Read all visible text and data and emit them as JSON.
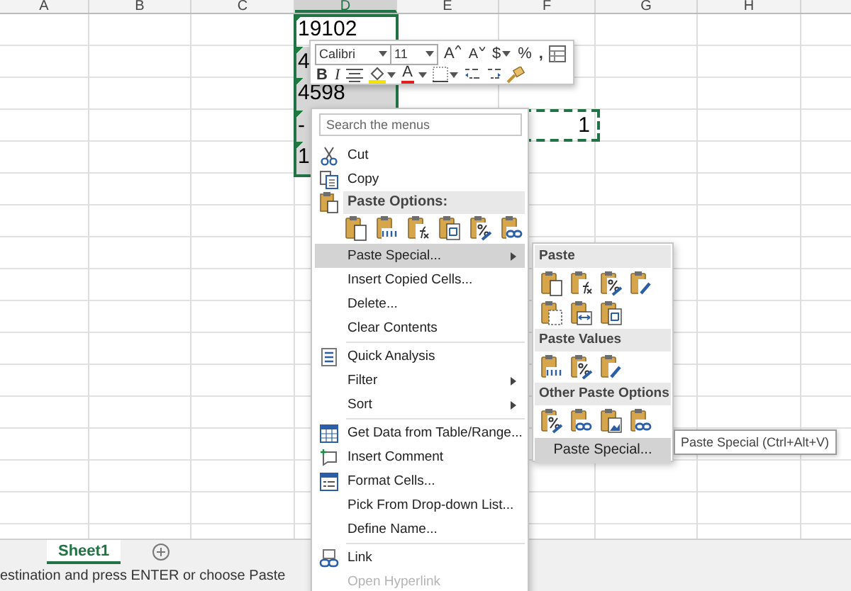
{
  "columns": [
    {
      "label": "A",
      "selected": false
    },
    {
      "label": "B",
      "selected": false
    },
    {
      "label": "C",
      "selected": false
    },
    {
      "label": "D",
      "selected": true
    },
    {
      "label": "E",
      "selected": false
    },
    {
      "label": "F",
      "selected": false
    },
    {
      "label": "G",
      "selected": false
    },
    {
      "label": "H",
      "selected": false
    }
  ],
  "selection": {
    "cells": [
      "19102",
      "4",
      "4598",
      "-",
      "1"
    ]
  },
  "copy_range": {
    "value": "1"
  },
  "mini_toolbar": {
    "row_1": [
      {
        "kind": "font",
        "value": "Calibri"
      },
      {
        "kind": "size",
        "value": "11"
      },
      {
        "kind": "grow",
        "text": "A"
      },
      {
        "kind": "shrink",
        "text": "A"
      },
      {
        "kind": "currency",
        "text": "$"
      },
      {
        "kind": "percent",
        "text": "%"
      },
      {
        "kind": "comma",
        "text": ","
      },
      {
        "kind": "format_table"
      }
    ],
    "row_2": [
      {
        "kind": "bold",
        "text": "B"
      },
      {
        "kind": "italic",
        "text": "I"
      },
      {
        "kind": "align"
      },
      {
        "kind": "fill"
      },
      {
        "kind": "font_color",
        "text": "A"
      },
      {
        "kind": "borders"
      },
      {
        "kind": "inc_decimal"
      },
      {
        "kind": "dec_decimal"
      },
      {
        "kind": "painter"
      }
    ]
  },
  "context_menu": {
    "search": {
      "placeholder": "Search the menus"
    },
    "items": [
      {
        "kind": "item",
        "label": "Cut",
        "selected": false,
        "disabled": false,
        "submenu": false
      },
      {
        "kind": "item",
        "label": "Copy",
        "selected": false,
        "disabled": false,
        "submenu": false
      },
      {
        "kind": "header",
        "label": "Paste Options:"
      },
      {
        "kind": "paste_icons"
      },
      {
        "kind": "item",
        "label": "Paste Special...",
        "selected": true,
        "disabled": false,
        "submenu": true
      },
      {
        "kind": "item",
        "label": "Insert Copied Cells...",
        "selected": false,
        "disabled": false,
        "submenu": false
      },
      {
        "kind": "item",
        "label": "Delete...",
        "selected": false,
        "disabled": false,
        "submenu": false
      },
      {
        "kind": "item",
        "label": "Clear Contents",
        "selected": false,
        "disabled": false,
        "submenu": false
      },
      {
        "kind": "separator"
      },
      {
        "kind": "item",
        "label": "Quick Analysis",
        "selected": false,
        "disabled": false,
        "submenu": false
      },
      {
        "kind": "item",
        "label": "Filter",
        "selected": false,
        "disabled": false,
        "submenu": true
      },
      {
        "kind": "item",
        "label": "Sort",
        "selected": false,
        "disabled": false,
        "submenu": true
      },
      {
        "kind": "separator"
      },
      {
        "kind": "item",
        "label": "Get Data from Table/Range...",
        "selected": false,
        "disabled": false,
        "submenu": false
      },
      {
        "kind": "item",
        "label": "Insert Comment",
        "selected": false,
        "disabled": false,
        "submenu": false
      },
      {
        "kind": "item",
        "label": "Format Cells...",
        "selected": false,
        "disabled": false,
        "submenu": false
      },
      {
        "kind": "item",
        "label": "Pick From Drop-down List...",
        "selected": false,
        "disabled": false,
        "submenu": false
      },
      {
        "kind": "item",
        "label": "Define Name...",
        "selected": false,
        "disabled": false,
        "submenu": false
      },
      {
        "kind": "separator"
      },
      {
        "kind": "item",
        "label": "Link",
        "selected": false,
        "disabled": false,
        "submenu": false
      },
      {
        "kind": "item",
        "label": "Open Hyperlink",
        "selected": false,
        "disabled": true,
        "submenu": false
      }
    ]
  },
  "paste_submenu": {
    "sections": [
      {
        "title": "Paste"
      },
      {
        "title": "Paste Values"
      },
      {
        "title": "Other Paste Options"
      }
    ],
    "footer": {
      "label": "Paste Special...",
      "selected": true
    }
  },
  "tooltip": {
    "text": "Paste Special (Ctrl+Alt+V)"
  },
  "sheet_tabs": [
    {
      "label": "Sheet1",
      "selected": true
    }
  ],
  "status_bar": {
    "text": "estination and press ENTER or choose Paste"
  }
}
